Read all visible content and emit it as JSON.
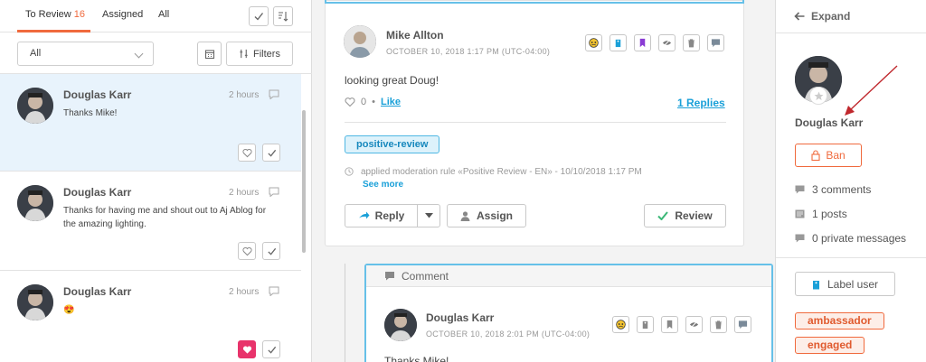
{
  "tabs": [
    {
      "label": "To Review",
      "count": "16"
    },
    {
      "label": "Assigned"
    },
    {
      "label": "All"
    }
  ],
  "toolbar": {
    "filter_value": "All",
    "filters_label": "Filters"
  },
  "list_items": [
    {
      "name": "Douglas Karr",
      "time": "2 hours",
      "text": "Thanks Mike!",
      "liked": false
    },
    {
      "name": "Douglas Karr",
      "time": "2 hours",
      "text": "Thanks for having me and shout out to Aj Ablog for the amazing lighting.",
      "liked": false
    },
    {
      "name": "Douglas Karr",
      "time": "2 hours",
      "text": "😍",
      "liked": true
    }
  ],
  "post": {
    "author": "Mike Allton",
    "date": "OCTOBER 10, 2018 1:17 PM (UTC-04:00)",
    "text": "looking great Doug!",
    "like_count": "0",
    "like_label": "Like",
    "replies_label": "1 Replies",
    "tag": "positive-review",
    "moderation_rule": "applied moderation rule «Positive Review - EN» - 10/10/2018 1:17 PM",
    "see_more": "See more",
    "reply_label": "Reply",
    "assign_label": "Assign",
    "review_label": "Review"
  },
  "comment": {
    "header_label": "Comment",
    "author": "Douglas Karr",
    "date": "OCTOBER 10, 2018 2:01 PM (UTC-04:00)",
    "text": "Thanks Mike!"
  },
  "profile": {
    "expand_label": "Expand",
    "name": "Douglas Karr",
    "ban_label": "Ban",
    "comments": "3 comments",
    "posts": "1 posts",
    "private_messages": "0 private messages",
    "label_user": "Label user",
    "tags": [
      "ambassador",
      "engaged"
    ]
  },
  "colors": {
    "accent": "#f06a3d",
    "link": "#1aa0d8",
    "selected": "#e8f3fc",
    "like_active": "#e8336b"
  }
}
